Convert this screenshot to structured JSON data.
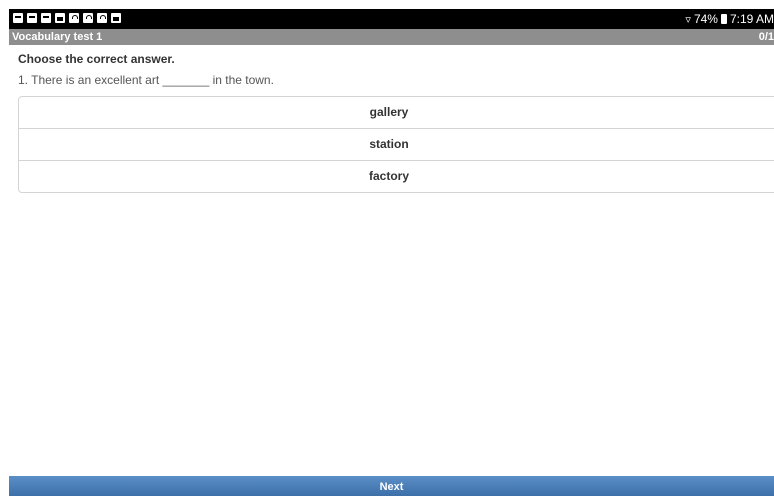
{
  "status_bar": {
    "notification_icons": [
      "mail-icon",
      "message-icon",
      "message-icon",
      "photo-icon",
      "bag-icon",
      "bag-icon",
      "bag-icon",
      "calendar-icon"
    ],
    "battery_percent": "74%",
    "time": "7:19 AM"
  },
  "title_bar": {
    "title": "Vocabulary test 1",
    "score": "0/1"
  },
  "quiz": {
    "instruction": "Choose the correct answer.",
    "question": "1. There is an excellent art _______ in the town.",
    "options": [
      "gallery",
      "station",
      "factory"
    ]
  },
  "footer": {
    "next_label": "Next"
  },
  "colors": {
    "status_bar_bg": "#000000",
    "title_bar_bg": "#8e8e8e",
    "next_bar_bg": "#4a7fb9"
  }
}
